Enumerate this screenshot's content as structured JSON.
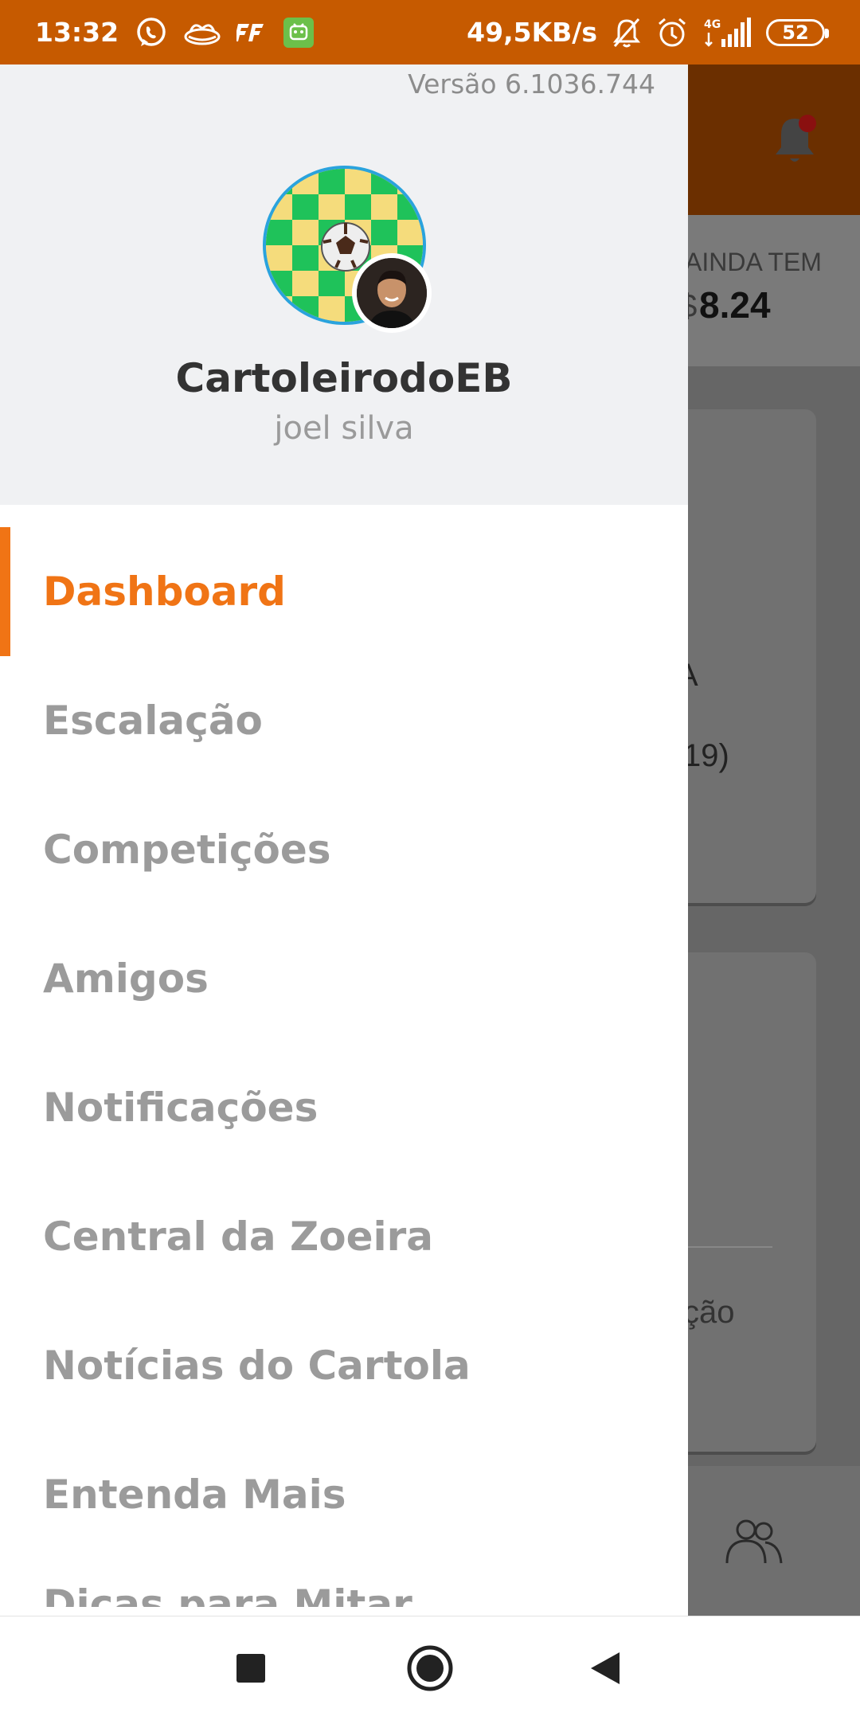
{
  "status_bar": {
    "time": "13:32",
    "network_speed": "49,5KB/s",
    "network_type": "4G",
    "battery": "52",
    "icons": [
      "whatsapp-icon",
      "app-icon",
      "ff-icon",
      "android-app-icon",
      "mute-icon",
      "alarm-icon",
      "signal-icon",
      "battery-icon"
    ]
  },
  "drawer": {
    "version": "Versão 6.1036.744",
    "team_name": "CartoleirodoEB",
    "user_name": "joel silva",
    "menu": [
      {
        "label": "Dashboard",
        "active": true
      },
      {
        "label": "Escalação",
        "active": false
      },
      {
        "label": "Competições",
        "active": false
      },
      {
        "label": "Amigos",
        "active": false
      },
      {
        "label": "Notificações",
        "active": false
      },
      {
        "label": "Central da Zoeira",
        "active": false
      },
      {
        "label": "Notícias do Cartola",
        "active": false
      },
      {
        "label": "Entenda Mais",
        "active": false
      },
      {
        "label": "Dicas para Mitar",
        "active": false
      }
    ]
  },
  "background": {
    "label": "AINDA TEM",
    "value_prefix": "$",
    "value": "8.24",
    "card_text_1": "(",
    "card_text_2": "A",
    "card_text_3": "19)",
    "card_text_4": "ção"
  },
  "colors": {
    "accent": "#f07415",
    "status_bar": "#c65a00",
    "menu_inactive": "#9b9b9b"
  }
}
